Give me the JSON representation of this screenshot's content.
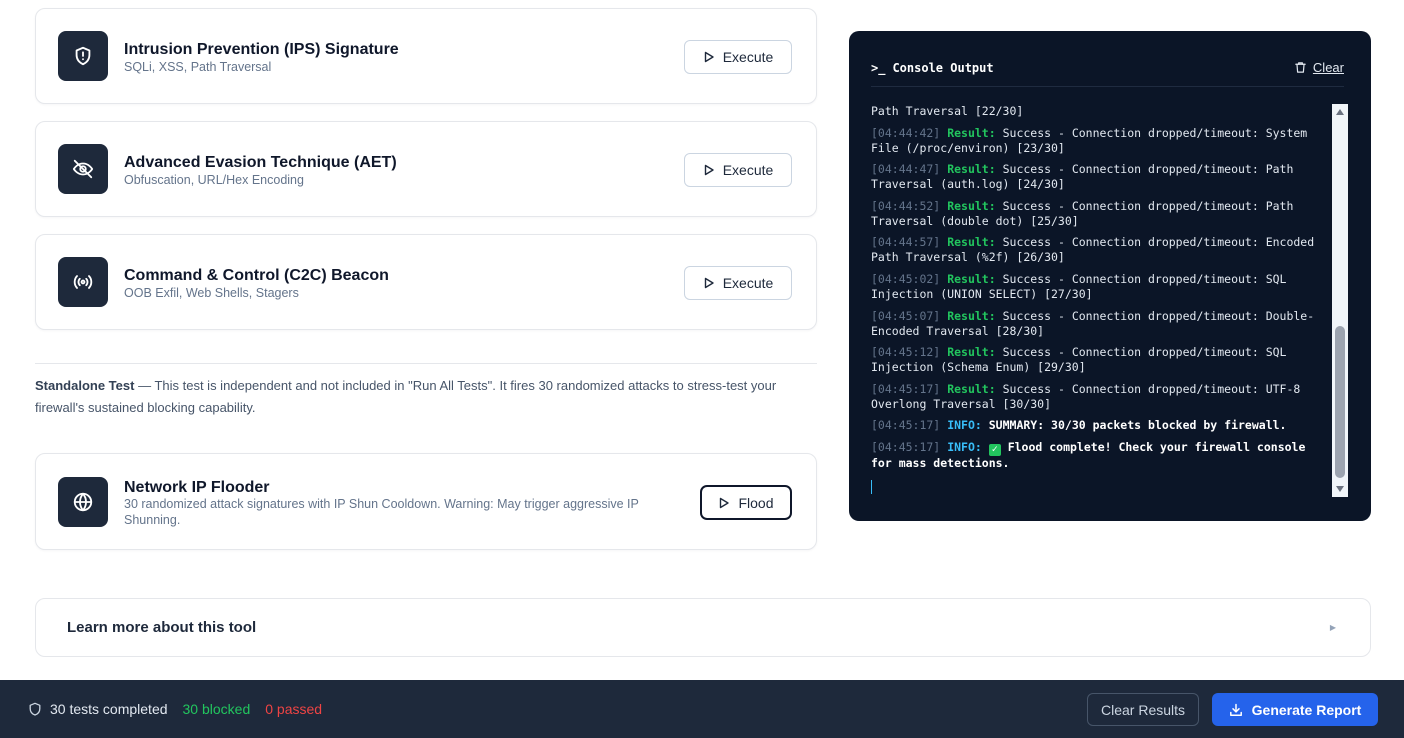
{
  "tests": [
    {
      "title": "Intrusion Prevention (IPS) Signature",
      "subtitle": "SQLi, XSS, Path Traversal",
      "action": "Execute",
      "icon": "shield-alert-icon"
    },
    {
      "title": "Advanced Evasion Technique (AET)",
      "subtitle": "Obfuscation, URL/Hex Encoding",
      "action": "Execute",
      "icon": "eye-off-icon"
    },
    {
      "title": "Command & Control (C2C) Beacon",
      "subtitle": "OOB Exfil, Web Shells, Stagers",
      "action": "Execute",
      "icon": "broadcast-icon"
    }
  ],
  "standalone": {
    "label": "Standalone Test",
    "text": " — This test is independent and not included in \"Run All Tests\". It fires 30 randomized attacks to stress-test your firewall's sustained blocking capability."
  },
  "flooder": {
    "title": "Network IP Flooder",
    "subtitle": "30 randomized attack signatures with IP Shun Cooldown. Warning: May trigger aggressive IP Shunning.",
    "action": "Flood",
    "icon": "globe-icon"
  },
  "console": {
    "prompt": ">_",
    "title": "Console Output",
    "clear_label": "Clear",
    "first_line": "Path Traversal [22/30]",
    "result_label": "Result:",
    "info_label": "INFO:",
    "entries": [
      {
        "ts": "[04:44:42]",
        "msg": "Success - Connection dropped/timeout: System File (/proc/environ) [23/30]"
      },
      {
        "ts": "[04:44:47]",
        "msg": "Success - Connection dropped/timeout: Path Traversal (auth.log) [24/30]"
      },
      {
        "ts": "[04:44:52]",
        "msg": "Success - Connection dropped/timeout: Path Traversal (double dot) [25/30]"
      },
      {
        "ts": "[04:44:57]",
        "msg": "Success - Connection dropped/timeout: Encoded Path Traversal (%2f) [26/30]"
      },
      {
        "ts": "[04:45:02]",
        "msg": "Success - Connection dropped/timeout: SQL Injection (UNION SELECT) [27/30]"
      },
      {
        "ts": "[04:45:07]",
        "msg": "Success - Connection dropped/timeout: Double-Encoded Traversal [28/30]"
      },
      {
        "ts": "[04:45:12]",
        "msg": "Success - Connection dropped/timeout: SQL Injection (Schema Enum) [29/30]"
      },
      {
        "ts": "[04:45:17]",
        "msg": "Success - Connection dropped/timeout: UTF-8 Overlong Traversal [30/30]"
      }
    ],
    "summary": {
      "ts": "[04:45:17]",
      "msg": "SUMMARY: 30/30 packets blocked by firewall."
    },
    "complete": {
      "ts": "[04:45:17]",
      "msg": "Flood complete! Check your firewall console for mass detections."
    }
  },
  "learn_more": {
    "label": "Learn more about this tool"
  },
  "footer": {
    "total": "30 tests completed",
    "blocked": "30 blocked",
    "passed": "0 passed",
    "clear_results": "Clear Results",
    "generate_report": "Generate Report"
  },
  "colors": {
    "console_bg": "#0b1527",
    "result_green": "#22c55e",
    "info_blue": "#38bdf8",
    "passed_red": "#ef4444",
    "primary_blue": "#2563eb",
    "footer_bg": "#1e293b"
  }
}
